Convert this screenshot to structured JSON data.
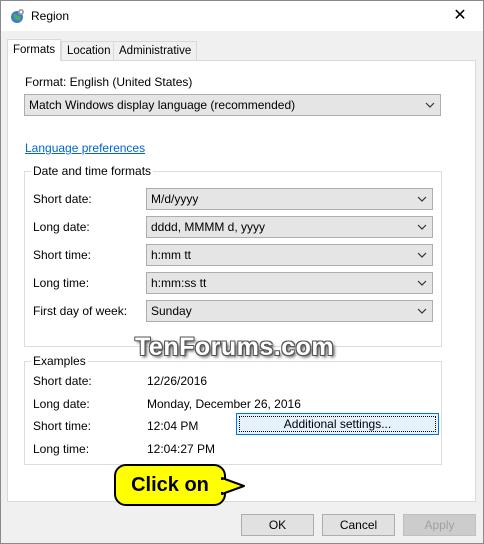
{
  "window": {
    "title": "Region",
    "close_glyph": "✕"
  },
  "tabs": [
    {
      "label": "Formats",
      "active": true
    },
    {
      "label": "Location",
      "active": false
    },
    {
      "label": "Administrative",
      "active": false
    }
  ],
  "format": {
    "label": "Format: English (United States)",
    "selected": "Match Windows display language (recommended)"
  },
  "language_link": "Language preferences",
  "date_time": {
    "group_title": "Date and time formats",
    "rows": [
      {
        "label": "Short date:",
        "value": "M/d/yyyy"
      },
      {
        "label": "Long date:",
        "value": "dddd, MMMM d, yyyy"
      },
      {
        "label": "Short time:",
        "value": "h:mm tt"
      },
      {
        "label": "Long time:",
        "value": "h:mm:ss tt"
      },
      {
        "label": "First day of week:",
        "value": "Sunday"
      }
    ]
  },
  "examples": {
    "group_title": "Examples",
    "rows": [
      {
        "label": "Short date:",
        "value": "12/26/2016"
      },
      {
        "label": "Long date:",
        "value": "Monday, December 26, 2016"
      },
      {
        "label": "Short time:",
        "value": "12:04 PM"
      },
      {
        "label": "Long time:",
        "value": "12:04:27 PM"
      }
    ]
  },
  "watermark": "TenForums.com",
  "additional_settings": "Additional settings...",
  "callout": "Click on",
  "buttons": {
    "ok": "OK",
    "cancel": "Cancel",
    "apply": "Apply"
  },
  "icons": {
    "app": "region-globe-icon",
    "dropdown": "chevron-down-icon",
    "close": "close-icon"
  }
}
